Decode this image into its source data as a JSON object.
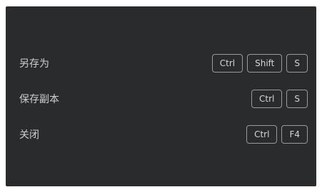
{
  "shortcuts": [
    {
      "label": "另存为",
      "keys": [
        "Ctrl",
        "Shift",
        "S"
      ]
    },
    {
      "label": "保存副本",
      "keys": [
        "Ctrl",
        "S"
      ]
    },
    {
      "label": "关闭",
      "keys": [
        "Ctrl",
        "F4"
      ]
    }
  ]
}
